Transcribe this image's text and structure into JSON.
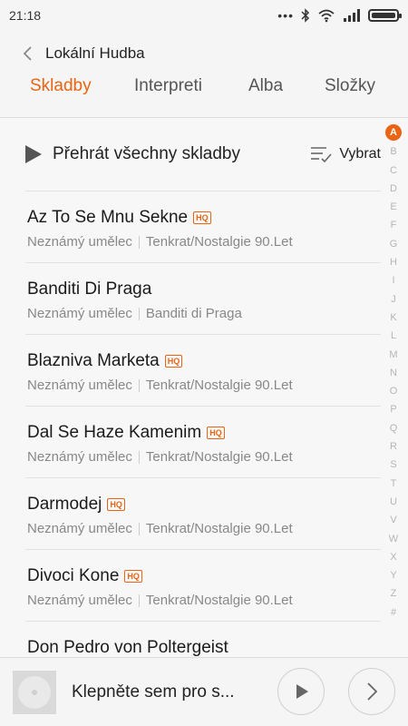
{
  "status_bar": {
    "time": "21:18",
    "icons": [
      "more-dots-icon",
      "bluetooth-icon",
      "wifi-icon",
      "signal-icon",
      "battery-icon"
    ],
    "battery_level": 1.0
  },
  "header": {
    "title": "Lokální Hudba",
    "tabs": [
      {
        "label": "Skladby",
        "active": true
      },
      {
        "label": "Interpreti",
        "active": false
      },
      {
        "label": "Alba",
        "active": false
      },
      {
        "label": "Složky",
        "active": false
      }
    ]
  },
  "actions": {
    "play_all_label": "Přehrát všechny skladby",
    "select_label": "Vybrat"
  },
  "songs": [
    {
      "title": "Az To Se Mnu Sekne",
      "hq": true,
      "artist": "Neznámý umělec",
      "album": "Tenkrat/Nostalgie 90.Let"
    },
    {
      "title": "Banditi Di Praga",
      "hq": false,
      "artist": "Neznámý umělec",
      "album": "Banditi di Praga"
    },
    {
      "title": "Blazniva Marketa",
      "hq": true,
      "artist": "Neznámý umělec",
      "album": "Tenkrat/Nostalgie 90.Let"
    },
    {
      "title": "Dal Se Haze Kamenim",
      "hq": true,
      "artist": "Neznámý umělec",
      "album": "Tenkrat/Nostalgie 90.Let"
    },
    {
      "title": "Darmodej",
      "hq": true,
      "artist": "Neznámý umělec",
      "album": "Tenkrat/Nostalgie 90.Let"
    },
    {
      "title": "Divoci Kone",
      "hq": true,
      "artist": "Neznámý umělec",
      "album": "Tenkrat/Nostalgie 90.Let"
    },
    {
      "title": "Don Pedro von Poltergeist",
      "hq": false,
      "artist": "",
      "album": ""
    }
  ],
  "hq_badge": "HQ",
  "alphabet": [
    "A",
    "B",
    "C",
    "D",
    "E",
    "F",
    "G",
    "H",
    "I",
    "J",
    "K",
    "L",
    "M",
    "N",
    "O",
    "P",
    "Q",
    "R",
    "S",
    "T",
    "U",
    "V",
    "W",
    "X",
    "Y",
    "Z",
    "#"
  ],
  "alphabet_active": "A",
  "player": {
    "title": "Klepněte sem pro s..."
  },
  "colors": {
    "accent": "#ea6413"
  }
}
